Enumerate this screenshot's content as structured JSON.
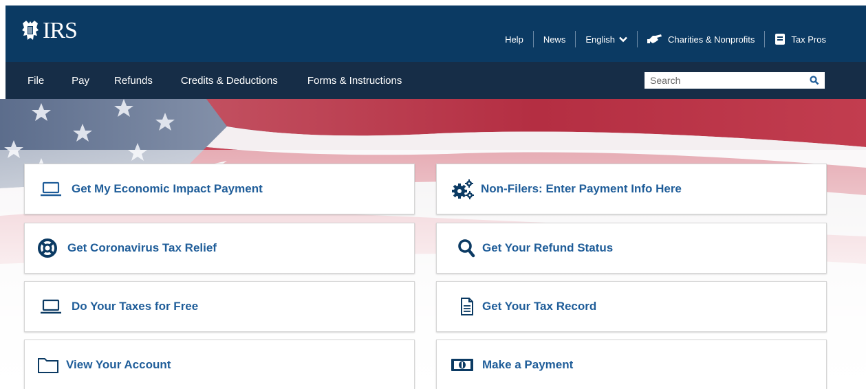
{
  "brand": {
    "logo_text": "IRS"
  },
  "util_nav": {
    "help": "Help",
    "news": "News",
    "language": "English",
    "charities": "Charities & Nonprofits",
    "tax_pros": "Tax Pros"
  },
  "main_nav": [
    "File",
    "Pay",
    "Refunds",
    "Credits & Deductions",
    "Forms & Instructions"
  ],
  "search": {
    "placeholder": "Search"
  },
  "cards": {
    "economic_payment": "Get My Economic Impact Payment",
    "non_filers": "Non-Filers: Enter Payment Info Here",
    "coronavirus_relief": "Get Coronavirus Tax Relief",
    "refund_status": "Get Your Refund Status",
    "taxes_free": "Do Your Taxes for Free",
    "tax_record": "Get Your Tax Record",
    "view_account": "View Your Account",
    "make_payment": "Make a Payment"
  },
  "colors": {
    "header_bg": "#0b3a63",
    "nav_bg": "#162d47",
    "link_blue": "#1f5d99"
  }
}
